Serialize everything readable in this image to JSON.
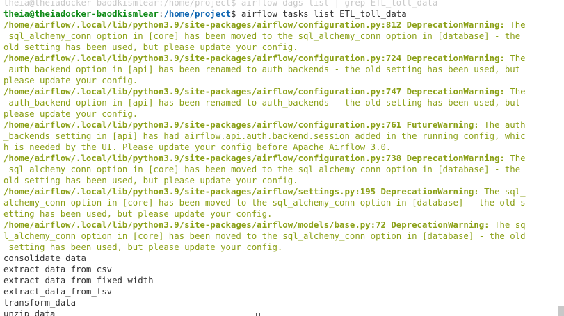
{
  "terminal": {
    "faded_top_line": "theia@theiadocker-baodkismlear:/home/project$ airflow dags list | grep ETL_toll_data",
    "prompt": {
      "user_host": "theia@theiadocker-baodkismlear",
      "separator": ":",
      "path": "/home/project",
      "symbol": "$ ",
      "command": "airflow tasks list ETL_toll_data"
    },
    "warning_lines": [
      {
        "path": "/home/airflow/.local/lib/python3.9/site-packages/airflow/configuration.py:812 DeprecationWarning:",
        "msg": " The"
      },
      {
        "path": "",
        "msg": " sql_alchemy_conn option in [core] has been moved to the sql_alchemy_conn option in [database] - the"
      },
      {
        "path": "",
        "msg": "old setting has been used, but please update your config."
      },
      {
        "path": "/home/airflow/.local/lib/python3.9/site-packages/airflow/configuration.py:724 DeprecationWarning:",
        "msg": " The"
      },
      {
        "path": "",
        "msg": " auth_backend option in [api] has been renamed to auth_backends - the old setting has been used, but"
      },
      {
        "path": "",
        "msg": "please update your config."
      },
      {
        "path": "/home/airflow/.local/lib/python3.9/site-packages/airflow/configuration.py:747 DeprecationWarning:",
        "msg": " The"
      },
      {
        "path": "",
        "msg": " auth_backend option in [api] has been renamed to auth_backends - the old setting has been used, but"
      },
      {
        "path": "",
        "msg": "please update your config."
      },
      {
        "path": "/home/airflow/.local/lib/python3.9/site-packages/airflow/configuration.py:761 FutureWarning:",
        "msg": " The auth"
      },
      {
        "path": "",
        "msg": "_backends setting in [api] has had airflow.api.auth.backend.session added in the running config, whic"
      },
      {
        "path": "",
        "msg": "h is needed by the UI. Please update your config before Apache Airflow 3.0."
      },
      {
        "path": "/home/airflow/.local/lib/python3.9/site-packages/airflow/configuration.py:738 DeprecationWarning:",
        "msg": " The"
      },
      {
        "path": "",
        "msg": " sql_alchemy_conn option in [core] has been moved to the sql_alchemy_conn option in [database] - the"
      },
      {
        "path": "",
        "msg": "old setting has been used, but please update your config."
      },
      {
        "path": "/home/airflow/.local/lib/python3.9/site-packages/airflow/settings.py:195 DeprecationWarning:",
        "msg": " The sql_"
      },
      {
        "path": "",
        "msg": "alchemy_conn option in [core] has been moved to the sql_alchemy_conn option in [database] - the old s"
      },
      {
        "path": "",
        "msg": "etting has been used, but please update your config."
      },
      {
        "path": "/home/airflow/.local/lib/python3.9/site-packages/airflow/models/base.py:72 DeprecationWarning:",
        "msg": " The sq"
      },
      {
        "path": "",
        "msg": "l_alchemy_conn option in [core] has been moved to the sql_alchemy_conn option in [database] - the old"
      },
      {
        "path": "",
        "msg": " setting has been used, but please update your config."
      }
    ],
    "task_output": [
      "consolidate_data",
      "extract_data_from_csv",
      "extract_data_from_fixed_width",
      "extract_data_from_tsv",
      "transform_data",
      "unzip_data"
    ],
    "colors": {
      "user_host": "#0e8a16",
      "path": "#0b63b0",
      "warning": "#8ba017",
      "text": "#333333",
      "background": "#ffffff"
    }
  }
}
